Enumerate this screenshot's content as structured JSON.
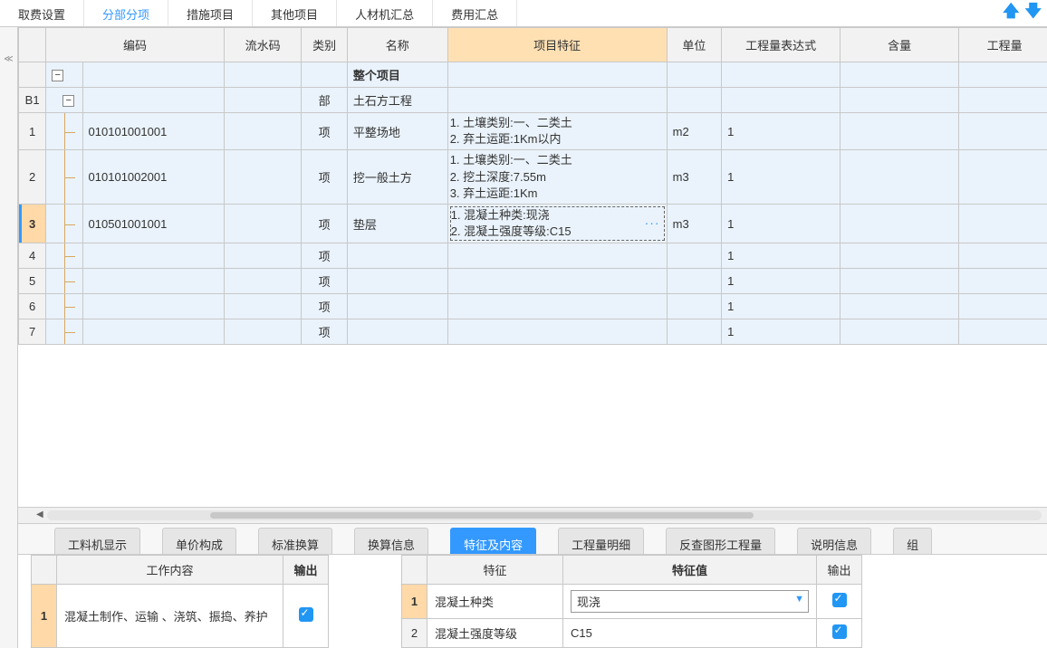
{
  "topTabs": [
    "取费设置",
    "分部分项",
    "措施项目",
    "其他项目",
    "人材机汇总",
    "费用汇总"
  ],
  "topActive": 1,
  "columns": {
    "code": "编码",
    "seq": "流水码",
    "cat": "类别",
    "name": "名称",
    "feat": "项目特征",
    "unit": "单位",
    "expr": "工程量表达式",
    "qty": "含量",
    "eng": "工程量"
  },
  "rootName": "整个项目",
  "b1": {
    "rownum": "B1",
    "cat": "部",
    "name": "土石方工程"
  },
  "rows": [
    {
      "n": "1",
      "code": "010101001001",
      "cat": "项",
      "name": "平整场地",
      "feat": "1. 土壤类别:一、二类土\n2. 弃土运距:1Km以内",
      "unit": "m2",
      "expr": "1"
    },
    {
      "n": "2",
      "code": "010101002001",
      "cat": "项",
      "name": "挖一般土方",
      "feat": "1. 土壤类别:一、二类土\n2. 挖土深度:7.55m\n3. 弃土运距:1Km",
      "unit": "m3",
      "expr": "1"
    },
    {
      "n": "3",
      "code": "010501001001",
      "cat": "项",
      "name": "垫层",
      "feat": "1. 混凝土种类:现浇\n2. 混凝土强度等级:C15",
      "unit": "m3",
      "expr": "1",
      "selected": true
    },
    {
      "n": "4",
      "cat": "项",
      "expr": "1"
    },
    {
      "n": "5",
      "cat": "项",
      "expr": "1"
    },
    {
      "n": "6",
      "cat": "项",
      "expr": "1"
    },
    {
      "n": "7",
      "cat": "项",
      "expr": "1"
    }
  ],
  "bottomTabs": [
    "工料机显示",
    "单价构成",
    "标准换算",
    "换算信息",
    "特征及内容",
    "工程量明细",
    "反查图形工程量",
    "说明信息",
    "组"
  ],
  "bottomActive": 4,
  "leftSub": {
    "headers": {
      "work": "工作内容",
      "out": "输出"
    },
    "rows": [
      {
        "n": "1",
        "work": "混凝土制作、运输 、浇筑、振捣、养护",
        "out": true
      }
    ]
  },
  "rightSub": {
    "headers": {
      "feat": "特征",
      "val": "特征值",
      "out": "输出"
    },
    "rows": [
      {
        "n": "1",
        "feat": "混凝土种类",
        "val": "现浇",
        "out": true,
        "selected": true
      },
      {
        "n": "2",
        "feat": "混凝土强度等级",
        "val": "C15",
        "out": true
      }
    ]
  }
}
